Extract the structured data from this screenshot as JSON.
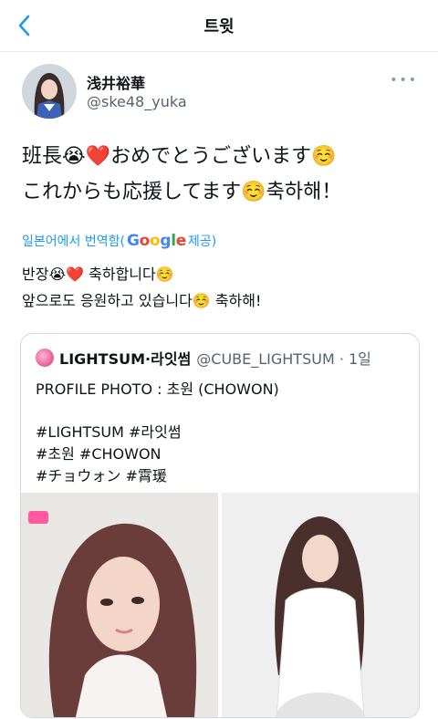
{
  "header": {
    "title": "트윗"
  },
  "tweet": {
    "author_name": "浅井裕華",
    "author_handle": "@ske48_yuka",
    "text_line1": "班長😭❤️おめでとうございます☺️",
    "text_line2": "これからも応援してます☺️축하해！",
    "translate_prefix": "일본어에서 번역함(",
    "translate_brand_letters": [
      "G",
      "o",
      "o",
      "g",
      "l",
      "e"
    ],
    "translate_suffix": " 제공)",
    "translated_line1": "반장😭❤️ 축하합니다☺️",
    "translated_line2": "앞으로도 응원하고 있습니다☺️ 축하해!"
  },
  "quote": {
    "name": "LIGHTSUM·라잇썸",
    "handle_time": "@CUBE_LIGHTSUM · 1일",
    "lines": [
      "PROFILE PHOTO : 초원 (CHOWON)",
      "#LIGHTSUM #라잇썸",
      "#초원 #CHOWON",
      "#チョウォン #霄瑗"
    ]
  },
  "colors": {
    "link": "#1d9bf0",
    "google": [
      "#4285F4",
      "#EA4335",
      "#FBBC05",
      "#4285F4",
      "#34A853",
      "#EA4335"
    ]
  }
}
